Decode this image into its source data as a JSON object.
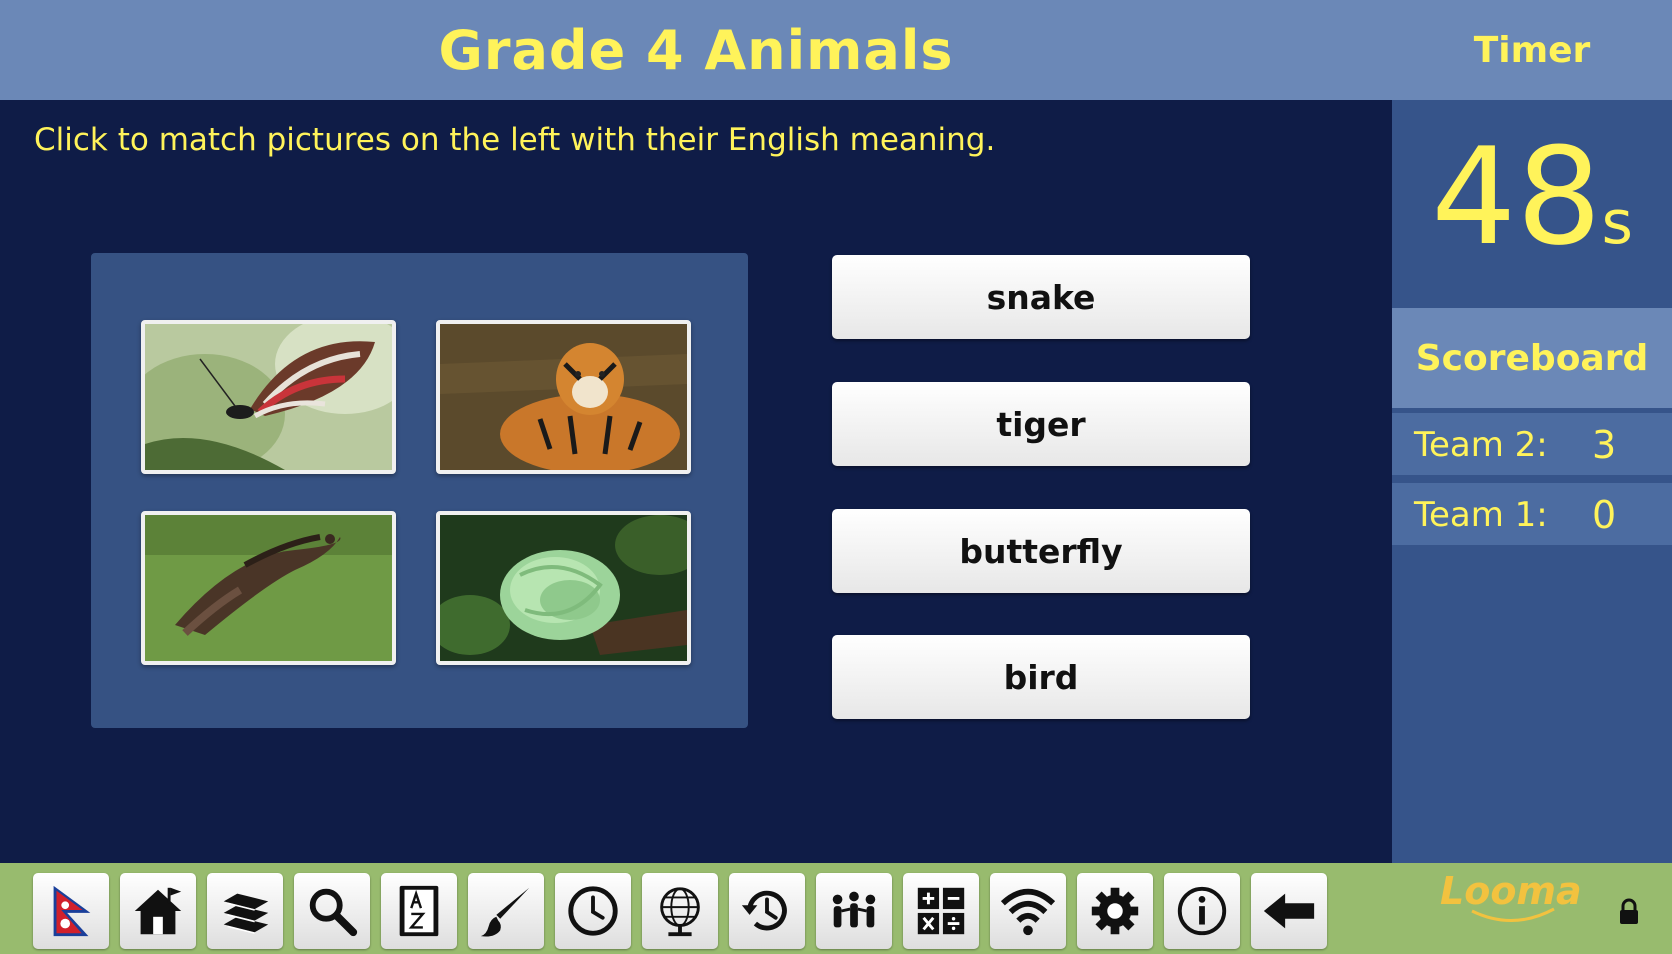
{
  "header": {
    "title": "Grade 4 Animals"
  },
  "instructions": "Click to match pictures on the left with their English meaning.",
  "pictures": [
    {
      "icon": "butterfly-photo"
    },
    {
      "icon": "tiger-photo"
    },
    {
      "icon": "bird-photo"
    },
    {
      "icon": "snake-photo"
    }
  ],
  "words": [
    "snake",
    "tiger",
    "butterfly",
    "bird"
  ],
  "timer": {
    "label": "Timer",
    "value": "48",
    "unit": "s"
  },
  "scoreboard": {
    "label": "Scoreboard",
    "teams": [
      {
        "name": "Team 2:",
        "score": "3"
      },
      {
        "name": "Team 1:",
        "score": "0"
      }
    ]
  },
  "toolbar": {
    "icons": [
      "nepal-flag-icon",
      "home-icon",
      "books-icon",
      "search-icon",
      "dictionary-icon",
      "paintbrush-icon",
      "clock-icon",
      "globe-icon",
      "history-icon",
      "people-icon",
      "calculator-icon",
      "wifi-icon",
      "settings-icon",
      "info-icon",
      "back-arrow-icon",
      "lock-icon"
    ]
  },
  "logo": "Looma",
  "colors": {
    "accent": "#fff35a",
    "header": "#6b88b7",
    "background": "#0f1c47",
    "toolbar": "#98bb6e",
    "logo": "#f2c23f"
  }
}
